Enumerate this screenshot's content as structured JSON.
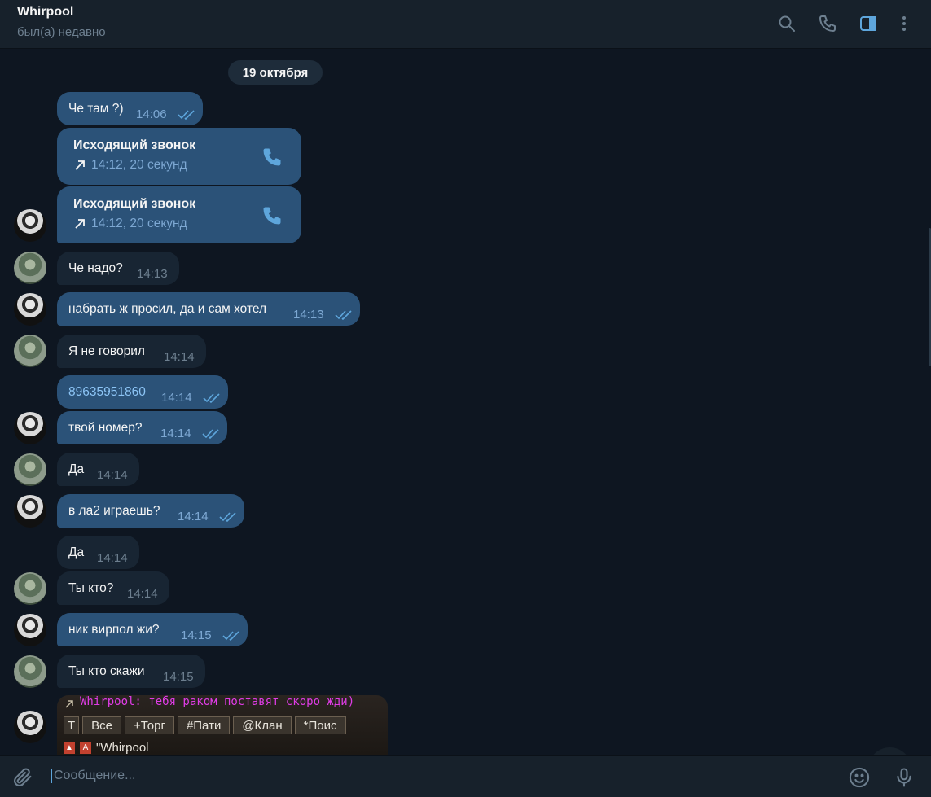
{
  "header": {
    "title": "Whirpool",
    "subtitle": "был(а) недавно",
    "icons": [
      "search-icon",
      "phone-icon",
      "sidebar-toggle-icon",
      "more-vertical-icon"
    ],
    "accent_color": "#5ea6dc"
  },
  "chat": {
    "date": "19 октября",
    "messages": [
      {
        "dir": "out",
        "text": "Че там ?)",
        "time": "14:06"
      },
      {
        "dir": "out",
        "type": "call",
        "title": "Исходящий звонок",
        "detail": "14:12, 20 секунд"
      },
      {
        "dir": "out",
        "type": "call",
        "title": "Исходящий звонок",
        "detail": "14:12, 20 секунд"
      },
      {
        "dir": "in",
        "text": "Че надо?",
        "time": "14:13"
      },
      {
        "dir": "out",
        "text": "набрать ж просил, да и сам хотел",
        "time": "14:13"
      },
      {
        "dir": "in",
        "text": "Я не говорил",
        "time": "14:14"
      },
      {
        "dir": "out",
        "text": "89635951860",
        "time": "14:14"
      },
      {
        "dir": "out",
        "text": "твой номер?",
        "time": "14:14"
      },
      {
        "dir": "in",
        "text": "Да",
        "time": "14:14"
      },
      {
        "dir": "out",
        "text": "в ла2 играешь?",
        "time": "14:14"
      },
      {
        "dir": "in",
        "text": "Да",
        "time": "14:14"
      },
      {
        "dir": "in",
        "text": "Ты кто?",
        "time": "14:14"
      },
      {
        "dir": "out",
        "text": "ник вирпол жи?",
        "time": "14:15"
      },
      {
        "dir": "in",
        "text": "Ты кто скажи",
        "time": "14:15"
      }
    ],
    "image": {
      "chat_line": "Whirpool: тебя раком поставят скоро жди)",
      "tabs": [
        "Все",
        "+Торг",
        "#Пати",
        "@Клан",
        "*Поис"
      ],
      "name_line": "\"Whirpool"
    }
  },
  "composer": {
    "placeholder": "Сообщение...",
    "icons": [
      "attach-icon",
      "emoji-icon",
      "microphone-icon"
    ]
  }
}
